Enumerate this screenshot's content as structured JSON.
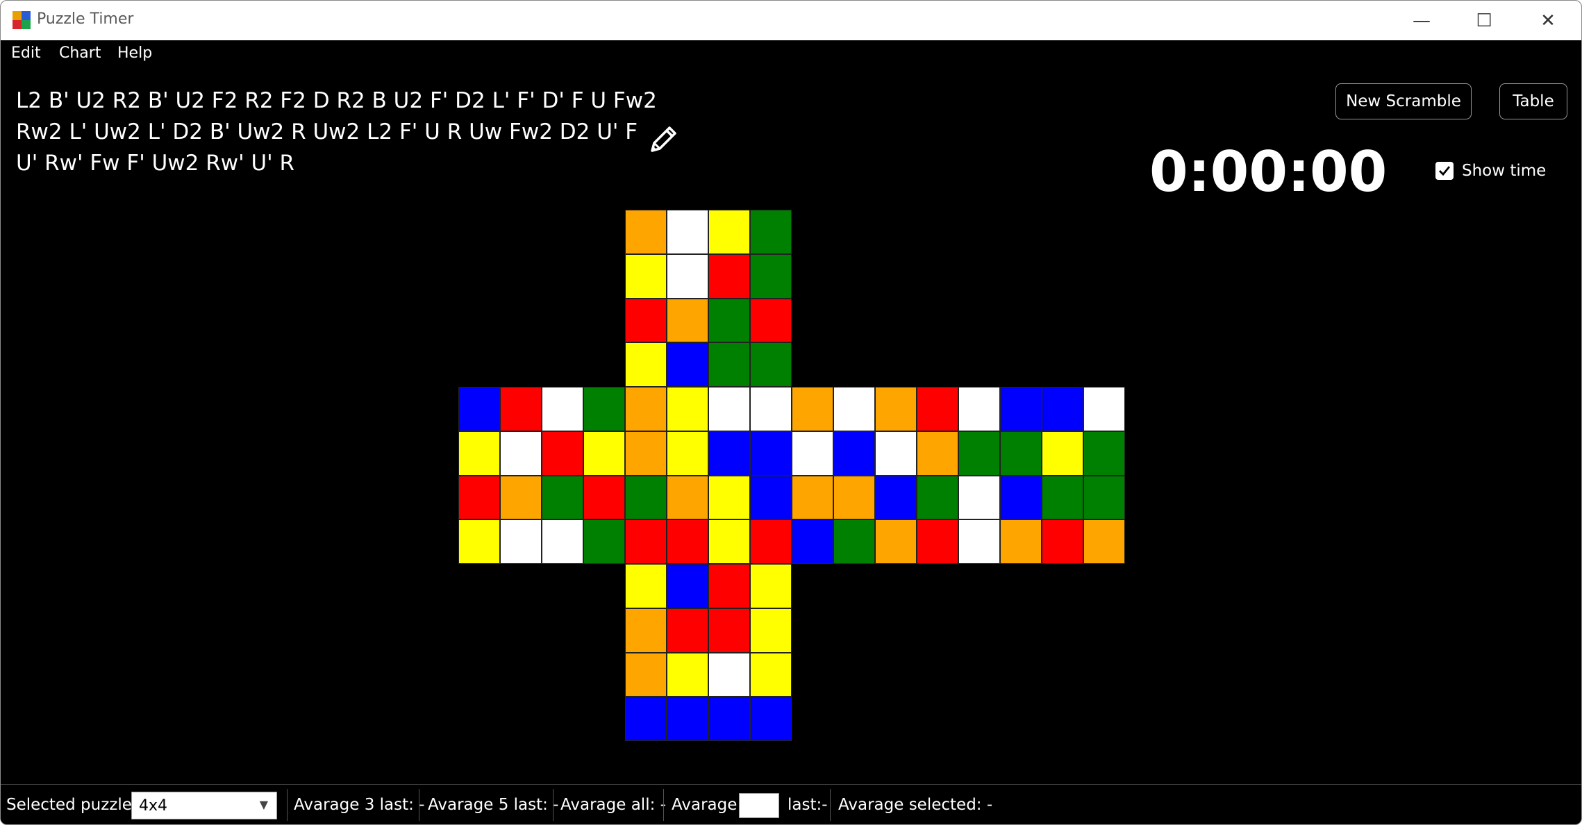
{
  "window": {
    "title": "Puzzle Timer",
    "controls": {
      "minimize": "—",
      "maximize": "☐",
      "close": "✕"
    }
  },
  "menu": {
    "items": [
      "Edit",
      "Chart",
      "Help"
    ]
  },
  "scramble": {
    "lines": [
      "L2 B' U2 R2 B' U2 F2 R2 F2 D R2 B U2 F' D2 L' F' D' F U Fw2",
      "Rw2 L' Uw2 L' D2 B' Uw2 R Uw2 L2 F' U R Uw Fw2 D2 U' F",
      "U' Rw' Fw F' Uw2 Rw' U' R"
    ]
  },
  "buttons": {
    "new_scramble": "New Scramble",
    "table": "Table"
  },
  "timer": {
    "display": "0:00:00"
  },
  "show_time": {
    "label": "Show time",
    "checked": true
  },
  "colors": {
    "O": "#ffa500",
    "W": "#ffffff",
    "Y": "#ffff00",
    "G": "#008000",
    "R": "#ff0000",
    "B": "#0000ff"
  },
  "cube": {
    "size": "4x4",
    "faces": {
      "up": [
        "OWYG",
        "YWRG",
        "ROGR",
        "YBGG"
      ],
      "left": [
        "BRWG",
        "YWRY",
        "ROGR",
        "YWWG"
      ],
      "front": [
        "OYWW",
        "OYBB",
        "GOYB",
        "RRYR"
      ],
      "right": [
        "OWOR",
        "WBWO",
        "OOBG",
        "BGOR"
      ],
      "back": [
        "WBBW",
        "GGYG",
        "WBGG",
        "WORO"
      ],
      "down": [
        "YBRY",
        "ORRY",
        "OYWY",
        "BBBB"
      ]
    }
  },
  "status": {
    "selected_puzzle_label": "Selected puzzle:",
    "selected_puzzle_value": "4x4",
    "avg3": "Avarage 3 last: -",
    "avg5": "Avarage 5 last: -",
    "avg_all": "Avarage all: -",
    "avg_label": "Avarage",
    "avg_last": "last:-",
    "avg_selected": "Avarage  selected: -"
  }
}
